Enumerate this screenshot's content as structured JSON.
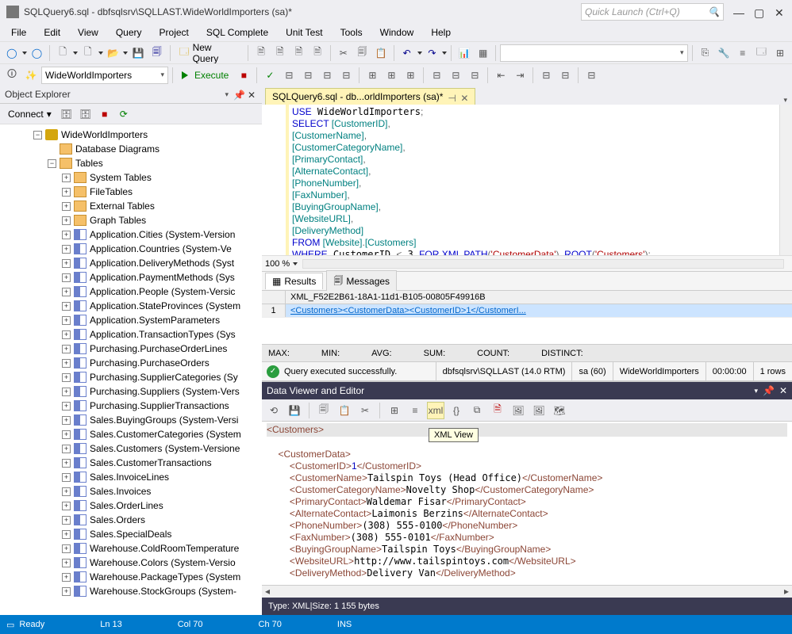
{
  "title": "SQLQuery6.sql - dbfsqlsrv\\SQLLAST.WideWorldImporters (sa)*",
  "quickLaunch": {
    "placeholder": "Quick Launch (Ctrl+Q)"
  },
  "menu": [
    "File",
    "Edit",
    "View",
    "Query",
    "Project",
    "SQL Complete",
    "Unit Test",
    "Tools",
    "Window",
    "Help"
  ],
  "toolbar2": {
    "newQuery": "New Query",
    "dbCombo": "WideWorldImporters",
    "execute": "Execute"
  },
  "objectExplorer": {
    "title": "Object Explorer",
    "connect": "Connect",
    "root": "WideWorldImporters",
    "folders": [
      "Database Diagrams",
      "Tables"
    ],
    "tableSubfolders": [
      "System Tables",
      "FileTables",
      "External Tables",
      "Graph Tables"
    ],
    "tables": [
      "Application.Cities (System-Version",
      "Application.Countries (System-Ve",
      "Application.DeliveryMethods (Syst",
      "Application.PaymentMethods (Sys",
      "Application.People (System-Versic",
      "Application.StateProvinces (System",
      "Application.SystemParameters",
      "Application.TransactionTypes (Sys",
      "Purchasing.PurchaseOrderLines",
      "Purchasing.PurchaseOrders",
      "Purchasing.SupplierCategories (Sy",
      "Purchasing.Suppliers (System-Vers",
      "Purchasing.SupplierTransactions",
      "Sales.BuyingGroups (System-Versi",
      "Sales.CustomerCategories (System",
      "Sales.Customers (System-Versione",
      "Sales.CustomerTransactions",
      "Sales.InvoiceLines",
      "Sales.Invoices",
      "Sales.OrderLines",
      "Sales.Orders",
      "Sales.SpecialDeals",
      "Warehouse.ColdRoomTemperature",
      "Warehouse.Colors (System-Versio",
      "Warehouse.PackageTypes (System",
      "Warehouse.StockGroups (System-"
    ]
  },
  "docTab": "SQLQuery6.sql - db...orldImporters (sa)*",
  "sql": {
    "l1a": "USE",
    "l1b": " WideWorldImporters",
    "l1c": ";",
    "l2a": "SELECT",
    "l2b": " [CustomerID]",
    "l2c": ",",
    "l3b": "[CustomerName]",
    "c": ",",
    "l4b": "[CustomerCategoryName]",
    "l5b": "[PrimaryContact]",
    "l6b": "[AlternateContact]",
    "l7b": "[PhoneNumber]",
    "l8b": "[FaxNumber]",
    "l9b": "[BuyingGroupName]",
    "l10b": "[WebsiteURL]",
    "l11b": "[DeliveryMethod]",
    "l12a": "FROM",
    "l12b": " [Website]",
    "l12c": ".",
    "l12d": "[Customers]",
    "l13a": "WHERE",
    "l13b": " CustomerID ",
    "l13c": "<",
    "l13d": " 3 ",
    "l13e": "FOR",
    "l13f": " XML PATH",
    "l13g": "(",
    "l13h": "'CustomerData'",
    "l13i": ")",
    "l13j": ",",
    "l13k": " ROOT",
    "l13l": "(",
    "l13m": "'Customers'",
    "l13n": ")",
    "l13o": ";"
  },
  "zoom": "100 %",
  "results": {
    "tabResults": "Results",
    "tabMessages": "Messages",
    "colHeader": "XML_F52E2B61-18A1-11d1-B105-00805F49916B",
    "rowNum": "1",
    "cellValue": "<Customers><CustomerData><CustomerID>1</CustomerI...",
    "stats": {
      "max": "MAX:",
      "min": "MIN:",
      "avg": "AVG:",
      "sum": "SUM:",
      "count": "COUNT:",
      "distinct": "DISTINCT:"
    },
    "statusOk": "Query executed successfully.",
    "statusServer": "dbfsqlsrv\\SQLLAST (14.0 RTM)",
    "statusUser": "sa (60)",
    "statusDb": "WideWorldImporters",
    "statusTime": "00:00:00",
    "statusRows": "1 rows"
  },
  "dataViewer": {
    "title": "Data Viewer and Editor",
    "tooltip": "XML View",
    "status": "Type: XML|Size: 1 155 bytes",
    "t": {
      "customers_o": "<Customers>",
      "cd_o": "<CustomerData>",
      "cid_o": "<CustomerID>",
      "cid_v": "1",
      "cid_c": "</CustomerID>",
      "cn_o": "<CustomerName>",
      "cn_v": "Tailspin Toys (Head Office)",
      "cn_c": "</CustomerName>",
      "cc_o": "<CustomerCategoryName>",
      "cc_v": "Novelty Shop",
      "cc_c": "</CustomerCategoryName>",
      "pc_o": "<PrimaryContact>",
      "pc_v": "Waldemar Fisar",
      "pc_c": "</PrimaryContact>",
      "ac_o": "<AlternateContact>",
      "ac_v": "Laimonis Berzins",
      "ac_c": "</AlternateContact>",
      "ph_o": "<PhoneNumber>",
      "ph_v": "(308) 555-0100",
      "ph_c": "</PhoneNumber>",
      "fx_o": "<FaxNumber>",
      "fx_v": "(308) 555-0101",
      "fx_c": "</FaxNumber>",
      "bg_o": "<BuyingGroupName>",
      "bg_v": "Tailspin Toys",
      "bg_c": "</BuyingGroupName>",
      "wu_o": "<WebsiteURL>",
      "wu_v": "http://www.tailspintoys.com",
      "wu_c": "</WebsiteURL>",
      "dm_o": "<DeliveryMethod>",
      "dm_v": "Delivery Van",
      "dm_c": "</DeliveryMethod>"
    }
  },
  "bottomStatus": {
    "ready": "Ready",
    "ln": "Ln 13",
    "col": "Col 70",
    "ch": "Ch 70",
    "ins": "INS"
  }
}
